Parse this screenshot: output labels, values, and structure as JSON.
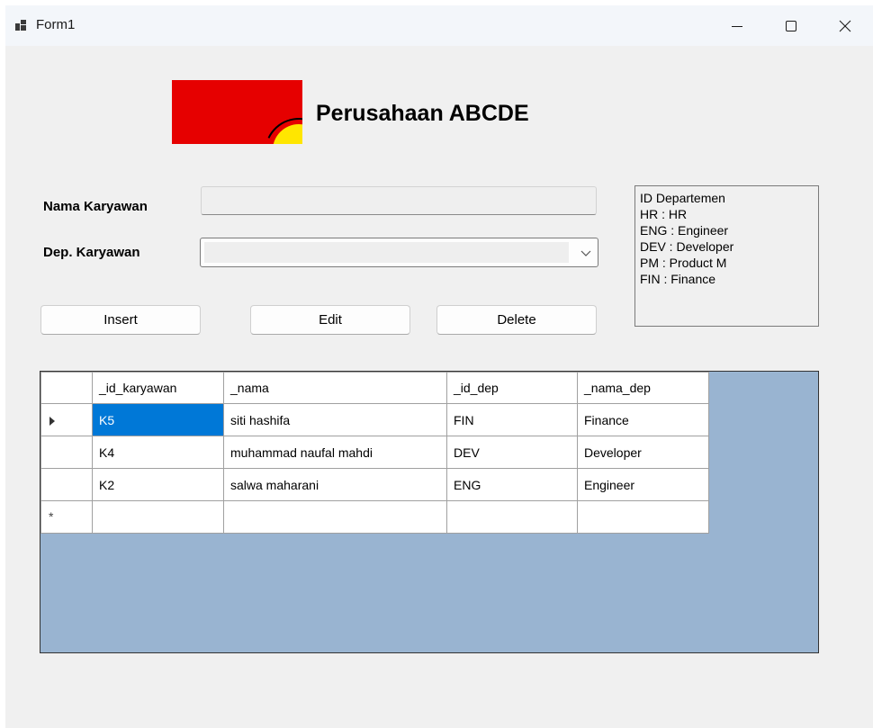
{
  "window": {
    "title": "Form1"
  },
  "header": {
    "company_name": "Perusahaan ABCDE"
  },
  "form": {
    "nama_label": "Nama Karyawan",
    "nama_value": "",
    "dep_label": "Dep. Karyawan",
    "dep_value": ""
  },
  "buttons": {
    "insert": "Insert",
    "edit": "Edit",
    "delete": "Delete"
  },
  "info": {
    "lines": [
      "ID Departemen",
      "HR : HR",
      "ENG : Engineer",
      "DEV : Developer",
      "PM : Product M",
      "FIN : Finance"
    ]
  },
  "grid": {
    "columns": [
      "_id_karyawan",
      "_nama",
      "_id_dep",
      "_nama_dep"
    ],
    "rows": [
      [
        "K5",
        "siti hashifa",
        "FIN",
        "Finance"
      ],
      [
        "K4",
        "muhammad naufal mahdi",
        "DEV",
        "Developer"
      ],
      [
        "K2",
        "salwa maharani",
        "ENG",
        "Engineer"
      ]
    ],
    "new_row_marker": "*"
  },
  "icons": {
    "app": "app-icon",
    "minimize": "minimize-icon",
    "maximize": "maximize-icon",
    "close": "close-icon",
    "dropdown": "chevron-down-icon",
    "current_row": "row-pointer-icon"
  },
  "colors": {
    "logo_red": "#e60000",
    "logo_yellow": "#ffe600",
    "grid_background": "#99b4d1",
    "selection": "#0078d7"
  }
}
